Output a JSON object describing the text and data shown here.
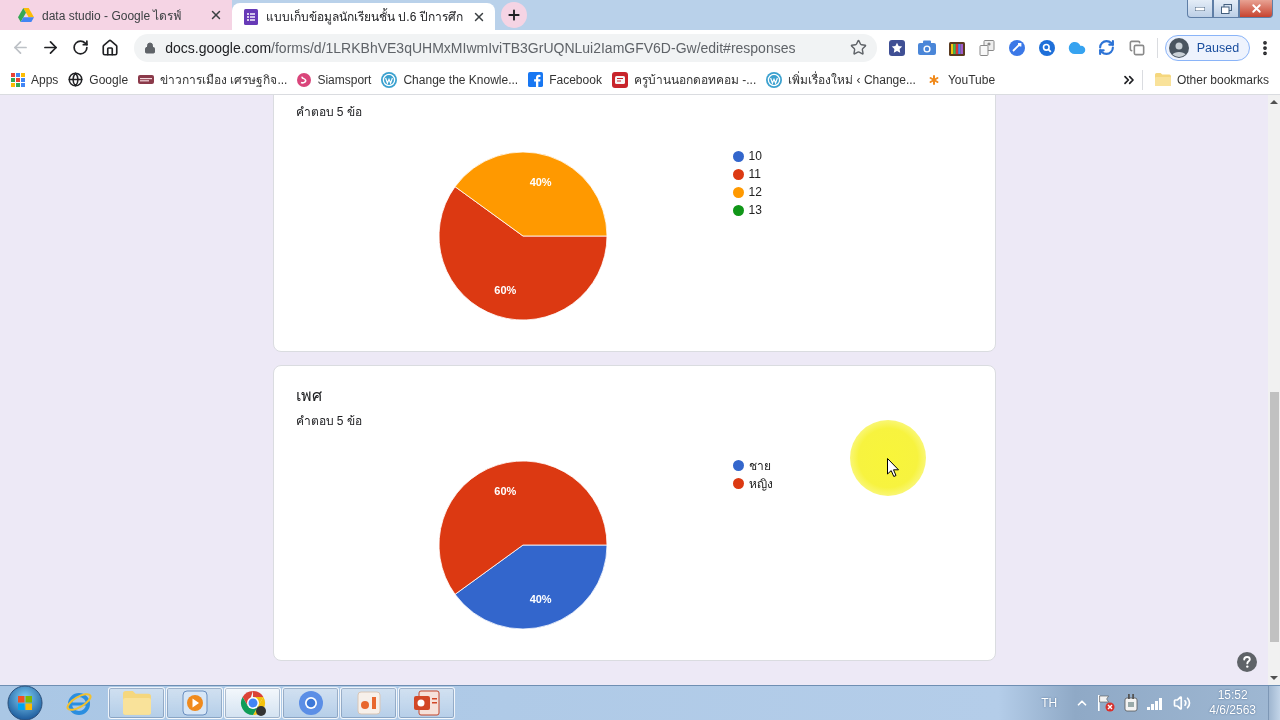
{
  "browser": {
    "tabs": [
      {
        "title": "data studio - Google ไดรฟ์",
        "selected": false
      },
      {
        "title": "แบบเก็บข้อมูลนักเรียนชั้น ป.6 ปีการศึก",
        "selected": true
      }
    ],
    "nav": {
      "back": {
        "disabled": true
      },
      "forward": {
        "disabled": false
      }
    },
    "url": {
      "host": "docs.google.com",
      "path": "/forms/d/1LRKBhVE3qUHMxMIwmIviTB3GrUQNLui2IamGFV6D-Gw/edit#responses"
    },
    "profile": {
      "label": "Paused"
    },
    "bookmarks": [
      {
        "label": "Apps"
      },
      {
        "label": "Google"
      },
      {
        "label": "ข่าวการเมือง เศรษฐกิจ..."
      },
      {
        "label": "Siamsport"
      },
      {
        "label": "Change the Knowle..."
      },
      {
        "label": "Facebook"
      },
      {
        "label": "ครูบ้านนอกดอทคอม -..."
      },
      {
        "label": "เพิ่มเรื่องใหม่ ‹ Change..."
      },
      {
        "label": "YouTube"
      }
    ],
    "other_bookmarks": {
      "label": "Other bookmarks"
    }
  },
  "page": {
    "cards": [
      {
        "subtitle": "คำตอบ 5 ข้อ",
        "legend_markers": [
          {
            "color": "#3366cc"
          },
          {
            "color": "#dc3912"
          },
          {
            "color": "#ff9900"
          },
          {
            "color": "#109618"
          }
        ],
        "chart_data": {
          "type": "pie",
          "categories": [
            "10",
            "11",
            "12",
            "13"
          ],
          "values": [
            0,
            60,
            40,
            0
          ],
          "value_labels": [
            null,
            "60%",
            "40%",
            null
          ],
          "legend": "right"
        }
      },
      {
        "title": "เพศ",
        "subtitle": "คำตอบ 5 ข้อ",
        "legend_markers": [
          {
            "color": "#3366cc"
          },
          {
            "color": "#dc3912"
          }
        ],
        "chart_data": {
          "type": "pie",
          "categories": [
            "ชาย",
            "หญิง"
          ],
          "values": [
            40,
            60
          ],
          "value_labels": [
            "40%",
            "60%"
          ],
          "legend": "right"
        }
      }
    ]
  },
  "taskbar": {
    "apps": [
      {
        "running": false,
        "selected": false
      },
      {
        "running": true,
        "selected": false
      },
      {
        "running": true,
        "selected": false
      },
      {
        "running": true,
        "selected": true
      },
      {
        "running": true,
        "selected": false
      },
      {
        "running": true,
        "selected": false
      },
      {
        "running": true,
        "selected": false
      }
    ],
    "language": "TH",
    "time": "15:52",
    "date": "4/6/2563"
  }
}
